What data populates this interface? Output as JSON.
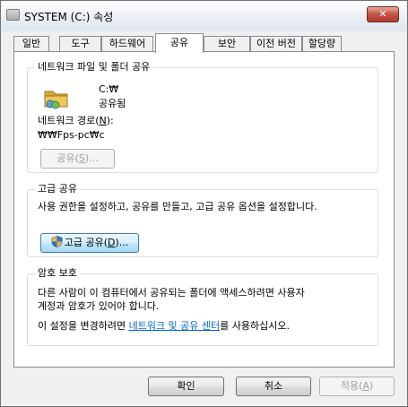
{
  "window": {
    "title": "SYSTEM (C:) 속성",
    "close_label": "✕"
  },
  "tabs": [
    {
      "label": "일반"
    },
    {
      "label": "도구"
    },
    {
      "label": "하드웨어"
    },
    {
      "label": "공유"
    },
    {
      "label": "보안"
    },
    {
      "label": "이전 버전"
    },
    {
      "label": "할당량"
    }
  ],
  "network_sharing": {
    "group_title": "네트워크 파일 및 폴더 공유",
    "drive": "C:₩",
    "status": "공유됨",
    "path_label_prefix": "네트워크 경로(",
    "path_label_key": "N",
    "path_label_suffix": "):",
    "path_value": "₩₩Fps-pc₩c",
    "share_button_prefix": "공유(",
    "share_button_key": "S",
    "share_button_suffix": ")...",
    "folder_icon": "shared-folder-icon"
  },
  "advanced_sharing": {
    "group_title": "고급 공유",
    "description": "사용 권한을 설정하고, 공유를 만들고, 고급 공유 옵션을 설정합니다.",
    "button_prefix": "고급 공유(",
    "button_key": "D",
    "button_suffix": ")...",
    "button_icon": "uac-shield-icon"
  },
  "password_protection": {
    "group_title": "암호 보호",
    "line1": "다른 사람이 이 컴퓨터에서 공유되는 폴더에 액세스하려면 사용자",
    "line2": "계정과 암호가 있어야 합니다.",
    "change_prefix": "이 설정을 변경하려면 ",
    "change_link": "네트워크 및 공유 센터",
    "change_suffix": "를 사용하십시오."
  },
  "footer": {
    "ok_label": "확인",
    "cancel_label": "취소",
    "apply_prefix": "적용(",
    "apply_key": "A",
    "apply_suffix": ")"
  }
}
